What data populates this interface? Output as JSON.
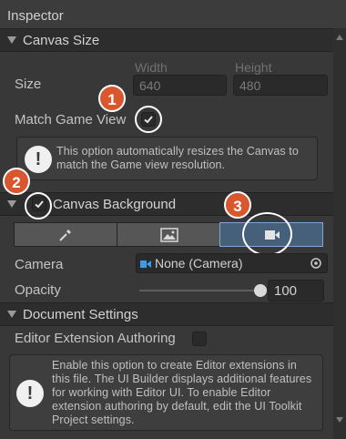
{
  "header": {
    "title": "Inspector"
  },
  "canvas_size": {
    "title": "Canvas Size",
    "size_label": "Size",
    "width_label": "Width",
    "height_label": "Height",
    "width_value": "640",
    "height_value": "480",
    "match_game_view_label": "Match Game View",
    "help_text": "This option automatically resizes the Canvas to match the Game view resolution."
  },
  "canvas_background": {
    "title": "Canvas Background",
    "camera_label": "Camera",
    "camera_value": "None (Camera)",
    "opacity_label": "Opacity",
    "opacity_value": "100",
    "opacity_fraction": 1.0,
    "modes": [
      {
        "icon": "eyedropper-icon"
      },
      {
        "icon": "image-icon"
      },
      {
        "icon": "video-camera-icon"
      }
    ]
  },
  "document_settings": {
    "title": "Document Settings",
    "editor_extension_label": "Editor Extension Authoring",
    "help_text": "Enable this option to create Editor extensions in this file. The UI Builder displays additional features for working with Editor UI. To enable Editor extension authoring by default, edit the UI Toolkit Project settings."
  },
  "callouts": [
    "1",
    "2",
    "3"
  ],
  "icons": {
    "help": "!"
  },
  "colors": {
    "callout": "#d9572f",
    "selected_segment": "#46607c"
  }
}
